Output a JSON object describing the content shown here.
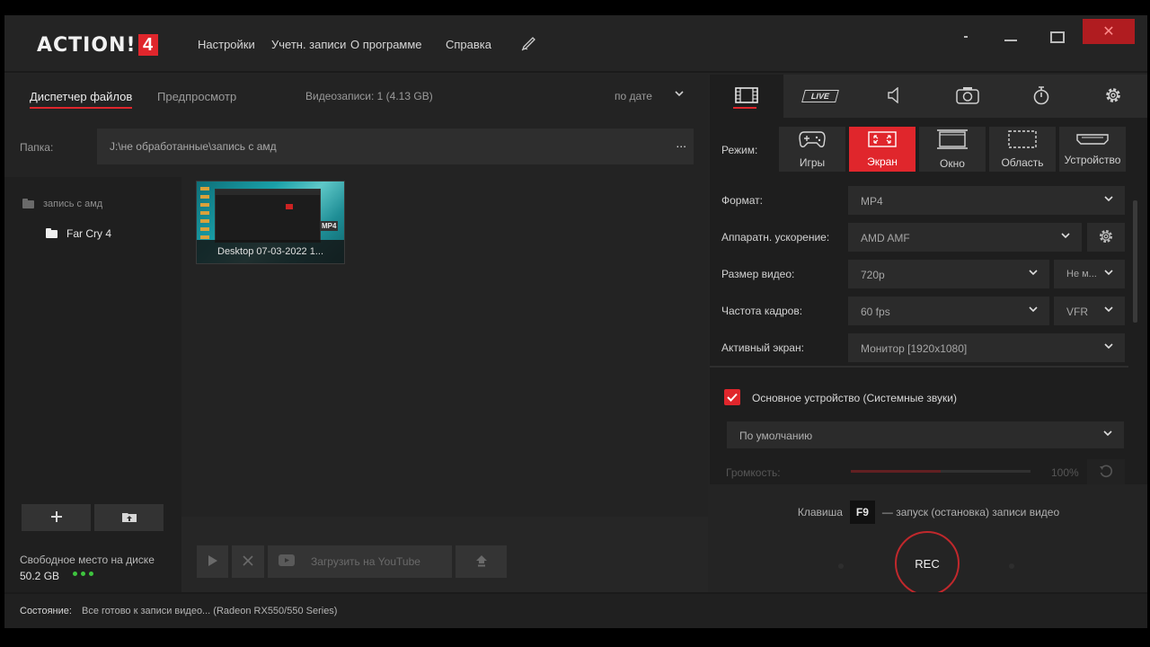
{
  "app": {
    "logo_text": "ACTION!",
    "logo_version": "4",
    "menu": [
      "Настройки",
      "Учетн. записи",
      "О программе",
      "Справка"
    ],
    "window_buttons": {
      "minimize": "-",
      "restore": "☐",
      "close": "✕"
    }
  },
  "left": {
    "tabs": [
      "Диспетчер файлов",
      "Предпросмотр"
    ],
    "recordings_count": "Видеозаписи: 1 (4.13 GB)",
    "sort": "по дате",
    "folder_label": "Папка:",
    "folder_path": "J:\\не обработанные\\запись с амд",
    "folder_more": "...",
    "tree": [
      {
        "label": "запись с амд"
      },
      {
        "label": "Far Cry 4"
      }
    ],
    "thumbnail": {
      "caption": "Desktop 07-03-2022 1...",
      "format_tag": "MP4"
    },
    "free_space_label": "Свободное место на диске",
    "free_space_value": "50.2 GB",
    "upload_youtube": "Загрузить на YouTube"
  },
  "right": {
    "mode_label": "Режим:",
    "modes": [
      "Игры",
      "Экран",
      "Окно",
      "Область",
      "Устройство"
    ],
    "live_label": "LIVE",
    "settings": [
      {
        "label": "Формат:",
        "value": "MP4"
      },
      {
        "label": "Аппаратн. ускорение:",
        "value": "AMD AMF"
      },
      {
        "label": "Размер видео:",
        "value": "720p",
        "extra": "Не м..."
      },
      {
        "label": "Частота кадров:",
        "value": "60 fps",
        "extra": "VFR"
      },
      {
        "label": "Активный экран:",
        "value": "Монитор [1920x1080]"
      }
    ],
    "audio_device_label": "Основное устройство (Системные звуки)",
    "audio_device_value": "По умолчанию",
    "volume_label": "Громкость:",
    "volume_value": "100%",
    "volume_level": 0.5,
    "hotkey_prefix": "Клавиша",
    "hotkey": "F9",
    "hotkey_suffix": "— запуск (остановка) записи видео",
    "rec_label": "REC"
  },
  "status": {
    "label": "Состояние:",
    "text": "Все готово к записи видео...  (Radeon RX550/550 Series)"
  },
  "colors": {
    "accent": "#e0262c",
    "bg": "#242424",
    "ok": "#3ec43e"
  }
}
